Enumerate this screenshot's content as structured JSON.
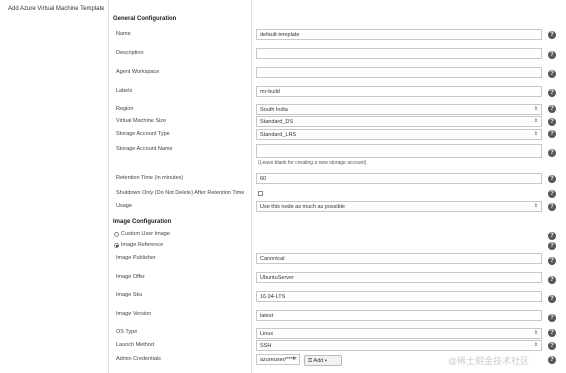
{
  "page": {
    "title": "Add Azure Virtual Machine Template"
  },
  "sections": {
    "general": "General Configuration",
    "image": "Image Configuration"
  },
  "fields": {
    "name": {
      "label": "Name",
      "value": "default-template"
    },
    "description": {
      "label": "Description",
      "value": ""
    },
    "agent_workspace": {
      "label": "Agent Workspace",
      "value": ""
    },
    "labels": {
      "label": "Labels",
      "value": "mr-build"
    },
    "region": {
      "label": "Region",
      "value": "South India"
    },
    "vm_size": {
      "label": "Virtual Machine Size",
      "value": "Standard_DS"
    },
    "storage_account_type": {
      "label": "Storage Account Type",
      "value": "Standard_LRS"
    },
    "storage_account_name": {
      "label": "Storage Account Name",
      "value": "",
      "note": "(Leave blank for creating a new storage account)"
    },
    "retention_time": {
      "label": "Retention Time (in minutes)",
      "value": "60"
    },
    "shutdown_only": {
      "label": "Shutdown Only (Do Not Delete) After Retention Time",
      "checked": false
    },
    "usage": {
      "label": "Usage",
      "value": "Use this node as much as possible"
    },
    "custom_user_image": {
      "label": "Custom User Image",
      "selected": false
    },
    "image_reference": {
      "label": "Image Reference",
      "selected": true
    },
    "image_publisher": {
      "label": "Image Publisher",
      "value": "Canonical"
    },
    "image_offer": {
      "label": "Image Offer",
      "value": "UbuntuServer"
    },
    "image_sku": {
      "label": "Image Sku",
      "value": "16.04-LTS"
    },
    "image_version": {
      "label": "Image Version",
      "value": "latest"
    },
    "os_type": {
      "label": "OS Type",
      "value": "Linux"
    },
    "launch_method": {
      "label": "Launch Method",
      "value": "SSH"
    },
    "admin_credentials": {
      "label": "Admin Credentials",
      "value": "azureuser/*****",
      "add_label": "Add"
    }
  },
  "watermark": "@稀土掘金技术社区"
}
